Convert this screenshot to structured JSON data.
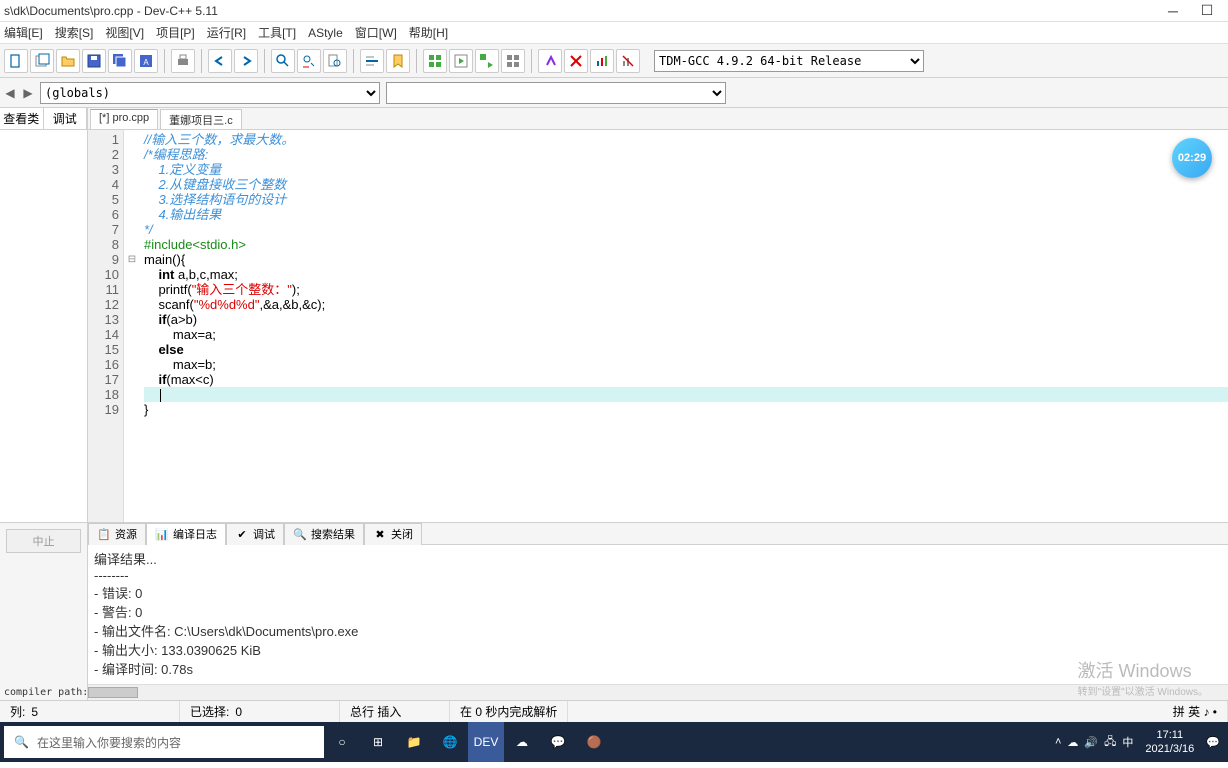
{
  "title": "s\\dk\\Documents\\pro.cpp - Dev-C++ 5.11",
  "menu": [
    "编辑[E]",
    "搜索[S]",
    "视图[V]",
    "项目[P]",
    "运行[R]",
    "工具[T]",
    "AStyle",
    "窗口[W]",
    "帮助[H]"
  ],
  "compiler_sel": "TDM-GCC 4.9.2 64-bit Release",
  "globals_sel": "(globals)",
  "left_tabs": [
    "查看类",
    "调试"
  ],
  "file_tabs": [
    "[*] pro.cpp",
    "董娜项目三.c"
  ],
  "code": {
    "lines": [
      {
        "n": 1,
        "html": "<span class='c-comment'>//输入三个数，求最大数。</span>"
      },
      {
        "n": 2,
        "html": "<span class='c-comment'>/*编程思路:</span>"
      },
      {
        "n": 3,
        "html": "<span class='c-comment'>    1.定义变量</span>"
      },
      {
        "n": 4,
        "html": "<span class='c-comment'>    2.从键盘接收三个整数</span>"
      },
      {
        "n": 5,
        "html": "<span class='c-comment'>    3.选择结构语句的设计</span>"
      },
      {
        "n": 6,
        "html": "<span class='c-comment'>    4.输出结果</span>"
      },
      {
        "n": 7,
        "html": "<span class='c-comment'>*/</span>"
      },
      {
        "n": 8,
        "html": "<span class='c-pre'>#include&lt;stdio.h&gt;</span>"
      },
      {
        "n": 9,
        "html": "main(){",
        "fold": "⊟"
      },
      {
        "n": 10,
        "html": "    <span class='c-kw'>int</span> a,b,c,max;"
      },
      {
        "n": 11,
        "html": "    printf(<span class='c-str'>\"输入三个整数：\"</span>);"
      },
      {
        "n": 12,
        "html": "    scanf(<span class='c-str'>\"%d%d%d\"</span>,&amp;a,&amp;b,&amp;c);"
      },
      {
        "n": 13,
        "html": "    <span class='c-kw'>if</span>(a&gt;b)"
      },
      {
        "n": 14,
        "html": "        max=a;"
      },
      {
        "n": 15,
        "html": "    <span class='c-kw'>else</span>"
      },
      {
        "n": 16,
        "html": "        max=b;"
      },
      {
        "n": 17,
        "html": "    <span class='c-kw'>if</span>(max&lt;c)"
      },
      {
        "n": 18,
        "html": "",
        "hl": true,
        "cursor": true
      },
      {
        "n": 19,
        "html": "}"
      }
    ]
  },
  "bottom_tabs": [
    {
      "label": "资源",
      "active": false
    },
    {
      "label": "编译日志",
      "active": true
    },
    {
      "label": "调试",
      "active": false
    },
    {
      "label": "搜索结果",
      "active": false
    },
    {
      "label": "关闭",
      "active": false
    }
  ],
  "compile_log": [
    "编译结果...",
    "--------",
    "- 错误: 0",
    "- 警告: 0",
    "- 输出文件名: C:\\Users\\dk\\Documents\\pro.exe",
    "- 输出大小: 133.0390625 KiB",
    "- 编译时间: 0.78s"
  ],
  "bottom_left": {
    "stop": "中止",
    "cp": "compiler path:"
  },
  "status": {
    "col_label": "列:",
    "col_val": "5",
    "sel_label": "已选择:",
    "sel_val": "0",
    "mode": "总行 插入",
    "parse": "在 0 秒内完成解析",
    "ime": "拼 英 ♪ •"
  },
  "taskbar": {
    "search_ph": "在这里输入你要搜索的内容",
    "time": "17:11",
    "date": "2021/3/16"
  },
  "badge": "02:29",
  "watermark": {
    "t1": "激活 Windows",
    "t2": "转到\"设置\"以激活 Windows。"
  }
}
